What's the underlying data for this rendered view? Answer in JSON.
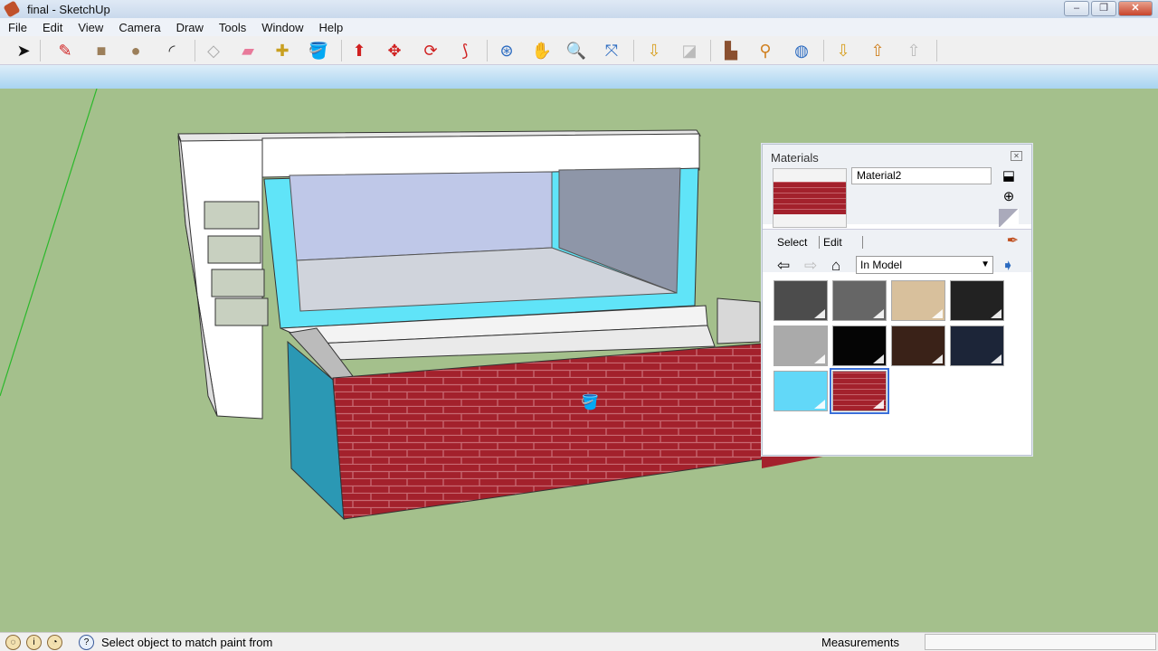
{
  "window": {
    "title": "final - SketchUp",
    "minimize": "–",
    "restore": "❐",
    "close": "✕"
  },
  "menu": [
    "File",
    "Edit",
    "View",
    "Camera",
    "Draw",
    "Tools",
    "Window",
    "Help"
  ],
  "tools": [
    {
      "name": "select",
      "glyph": "➤",
      "color": "#111",
      "group": 0
    },
    {
      "name": "pencil",
      "glyph": "✎",
      "color": "#d02020",
      "group": 1
    },
    {
      "name": "rectangle",
      "glyph": "■",
      "color": "#9c7f5a",
      "group": 1
    },
    {
      "name": "circle",
      "glyph": "●",
      "color": "#9c7f5a",
      "group": 1
    },
    {
      "name": "arc",
      "glyph": "◜",
      "color": "#333",
      "group": 1
    },
    {
      "name": "make-component",
      "glyph": "◇",
      "color": "#aaa",
      "group": 2
    },
    {
      "name": "eraser",
      "glyph": "▰",
      "color": "#e87a9a",
      "group": 2
    },
    {
      "name": "tape-measure",
      "glyph": "✚",
      "color": "#c9a020",
      "group": 2
    },
    {
      "name": "paint-bucket",
      "glyph": "🪣",
      "color": "#6a8a20",
      "group": 2
    },
    {
      "name": "push-pull",
      "glyph": "⬆",
      "color": "#d02020",
      "group": 3
    },
    {
      "name": "move",
      "glyph": "✥",
      "color": "#d02020",
      "group": 3
    },
    {
      "name": "rotate",
      "glyph": "⟳",
      "color": "#d02020",
      "group": 3
    },
    {
      "name": "offset",
      "glyph": "⟆",
      "color": "#d02020",
      "group": 3
    },
    {
      "name": "orbit",
      "glyph": "⊛",
      "color": "#2a6ac0",
      "group": 4
    },
    {
      "name": "pan",
      "glyph": "✋",
      "color": "#555",
      "group": 4
    },
    {
      "name": "zoom",
      "glyph": "🔍",
      "color": "#333",
      "group": 4
    },
    {
      "name": "zoom-extents",
      "glyph": "⤧",
      "color": "#2a6ac0",
      "group": 4
    },
    {
      "name": "get-current-view",
      "glyph": "⇩",
      "color": "#d8a020",
      "group": 5
    },
    {
      "name": "toggle-terrain",
      "glyph": "◪",
      "color": "#bbb",
      "group": 5
    },
    {
      "name": "add-building",
      "glyph": "▙",
      "color": "#8a5030",
      "group": 6
    },
    {
      "name": "add-location",
      "glyph": "⚲",
      "color": "#d08020",
      "group": 6
    },
    {
      "name": "preview-google-earth",
      "glyph": "◍",
      "color": "#2a6ac0",
      "group": 6
    },
    {
      "name": "get-models",
      "glyph": "⇩",
      "color": "#d8a020",
      "group": 7
    },
    {
      "name": "share-model",
      "glyph": "⇧",
      "color": "#d08020",
      "group": 7
    },
    {
      "name": "share-component",
      "glyph": "⇧",
      "color": "#bbb",
      "group": 7
    }
  ],
  "materials": {
    "title": "Materials",
    "close": "✕",
    "current_name": "Material2",
    "tabs": {
      "select": "Select",
      "edit": "Edit"
    },
    "library": "In Model",
    "swatches": [
      {
        "name": "dark-gray",
        "color": "#4c4c4c"
      },
      {
        "name": "gray",
        "color": "#666666"
      },
      {
        "name": "tan",
        "color": "#d8c09c"
      },
      {
        "name": "charcoal",
        "color": "#222222"
      },
      {
        "name": "light-gray",
        "color": "#aaaaaa"
      },
      {
        "name": "black",
        "color": "#050505"
      },
      {
        "name": "dark-brown",
        "color": "#3a2218"
      },
      {
        "name": "navy",
        "color": "#1c2538"
      },
      {
        "name": "cyan",
        "color": "#62d8f8"
      },
      {
        "name": "brick",
        "color": "#a3212c",
        "selected": true
      }
    ]
  },
  "status": {
    "hint": "Select object to match paint from",
    "measurements_label": "Measurements",
    "help": "?"
  }
}
